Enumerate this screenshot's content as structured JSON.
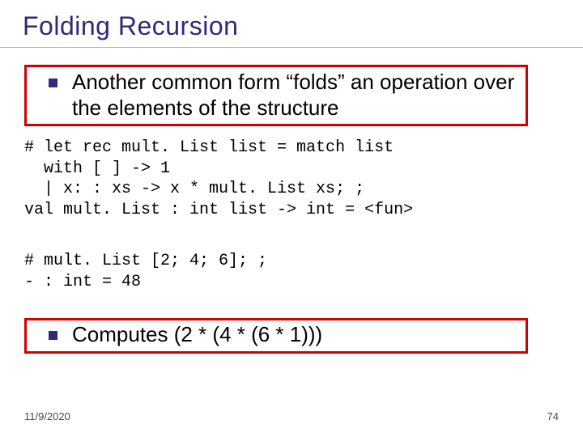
{
  "title": "Folding Recursion",
  "bullet1": "Another common form “folds” an operation over the elements of the structure",
  "code_block1": "# let rec mult. List list = match list\n  with [ ] -> 1\n  | x: : xs -> x * mult. List xs; ;\nval mult. List : int list -> int = <fun>",
  "code_block2": "# mult. List [2; 4; 6]; ;\n- : int = 48",
  "bullet2": "Computes (2 * (4 * (6 * 1)))",
  "footer": {
    "date": "11/9/2020",
    "page": "74"
  },
  "colors": {
    "title": "#302a78",
    "highlight_border": "#d20000"
  }
}
